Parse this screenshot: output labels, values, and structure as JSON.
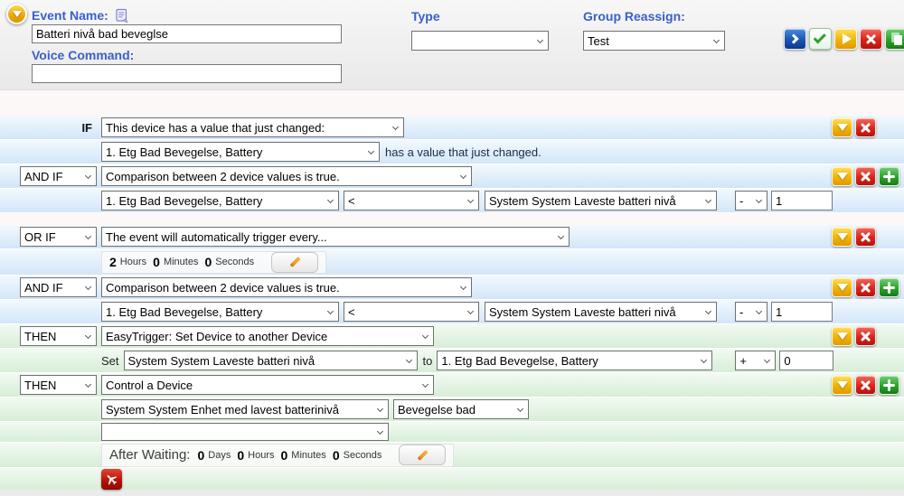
{
  "header": {
    "event_name_label": "Event Name:",
    "event_name_value": "Batteri nivå bad beveglse",
    "voice_command_label": "Voice Command:",
    "voice_command_value": "",
    "type_label": "Type",
    "type_value": "",
    "group_reassign_label": "Group Reassign:",
    "group_reassign_value": "Test"
  },
  "icons": {
    "collapse_event": "chevron-down-circle",
    "event_note": "note-document",
    "run": "chevron-right",
    "save": "green-check",
    "play": "play-triangle",
    "delete": "red-x",
    "copy": "copy-pages",
    "edit": "orange-pencil",
    "airplane": "airplane"
  },
  "colors": {
    "label_blue": "#3a5fc8",
    "condition_row_blue": "#d2e6f8",
    "action_row_green": "#d7eed7",
    "button_yellow": "#f2b406",
    "button_red": "#d8251a",
    "button_green": "#2aa22a",
    "button_blue": "#1c55ae"
  },
  "conditions": {
    "if1": {
      "label": "IF",
      "type": "This device has a value that just changed:",
      "device": "1. Etg Bad Bevegelse, Battery",
      "suffix": "has a value that just changed."
    },
    "and_if_1": {
      "label": "AND IF",
      "type": "Comparison between 2 device values is true.",
      "device_a": "1. Etg Bad Bevegelse, Battery",
      "operator": "<",
      "device_b": "System System Laveste batteri nivå",
      "offset_operator": "-",
      "offset_value": "1"
    },
    "or_if": {
      "label": "OR IF",
      "type": "The event will automatically trigger every...",
      "interval": {
        "hours": "2",
        "hours_unit": "Hours",
        "minutes": "0",
        "minutes_unit": "Minutes",
        "seconds": "0",
        "seconds_unit": "Seconds"
      }
    },
    "and_if_2": {
      "label": "AND IF",
      "type": "Comparison between 2 device values is true.",
      "device_a": "1. Etg Bad Bevegelse, Battery",
      "operator": "<",
      "device_b": "System System Laveste batteri nivå",
      "offset_operator": "-",
      "offset_value": "1"
    },
    "then_1": {
      "label": "THEN",
      "type": "EasyTrigger: Set Device to another Device",
      "set_label": "Set",
      "target_device": "System System Laveste batteri nivå",
      "to_label": "to",
      "source_device": "1. Etg Bad Bevegelse, Battery",
      "offset_operator": "+",
      "offset_value": "0"
    },
    "then_2": {
      "label": "THEN",
      "type": "Control a Device",
      "device": "System System Enhet med lavest batterinivå",
      "action": "Bevegelse bad",
      "extra_option": "",
      "after_waiting": {
        "label": "After Waiting:",
        "days": "0",
        "days_unit": "Days",
        "hours": "0",
        "hours_unit": "Hours",
        "minutes": "0",
        "minutes_unit": "Minutes",
        "seconds": "0",
        "seconds_unit": "Seconds"
      }
    }
  }
}
